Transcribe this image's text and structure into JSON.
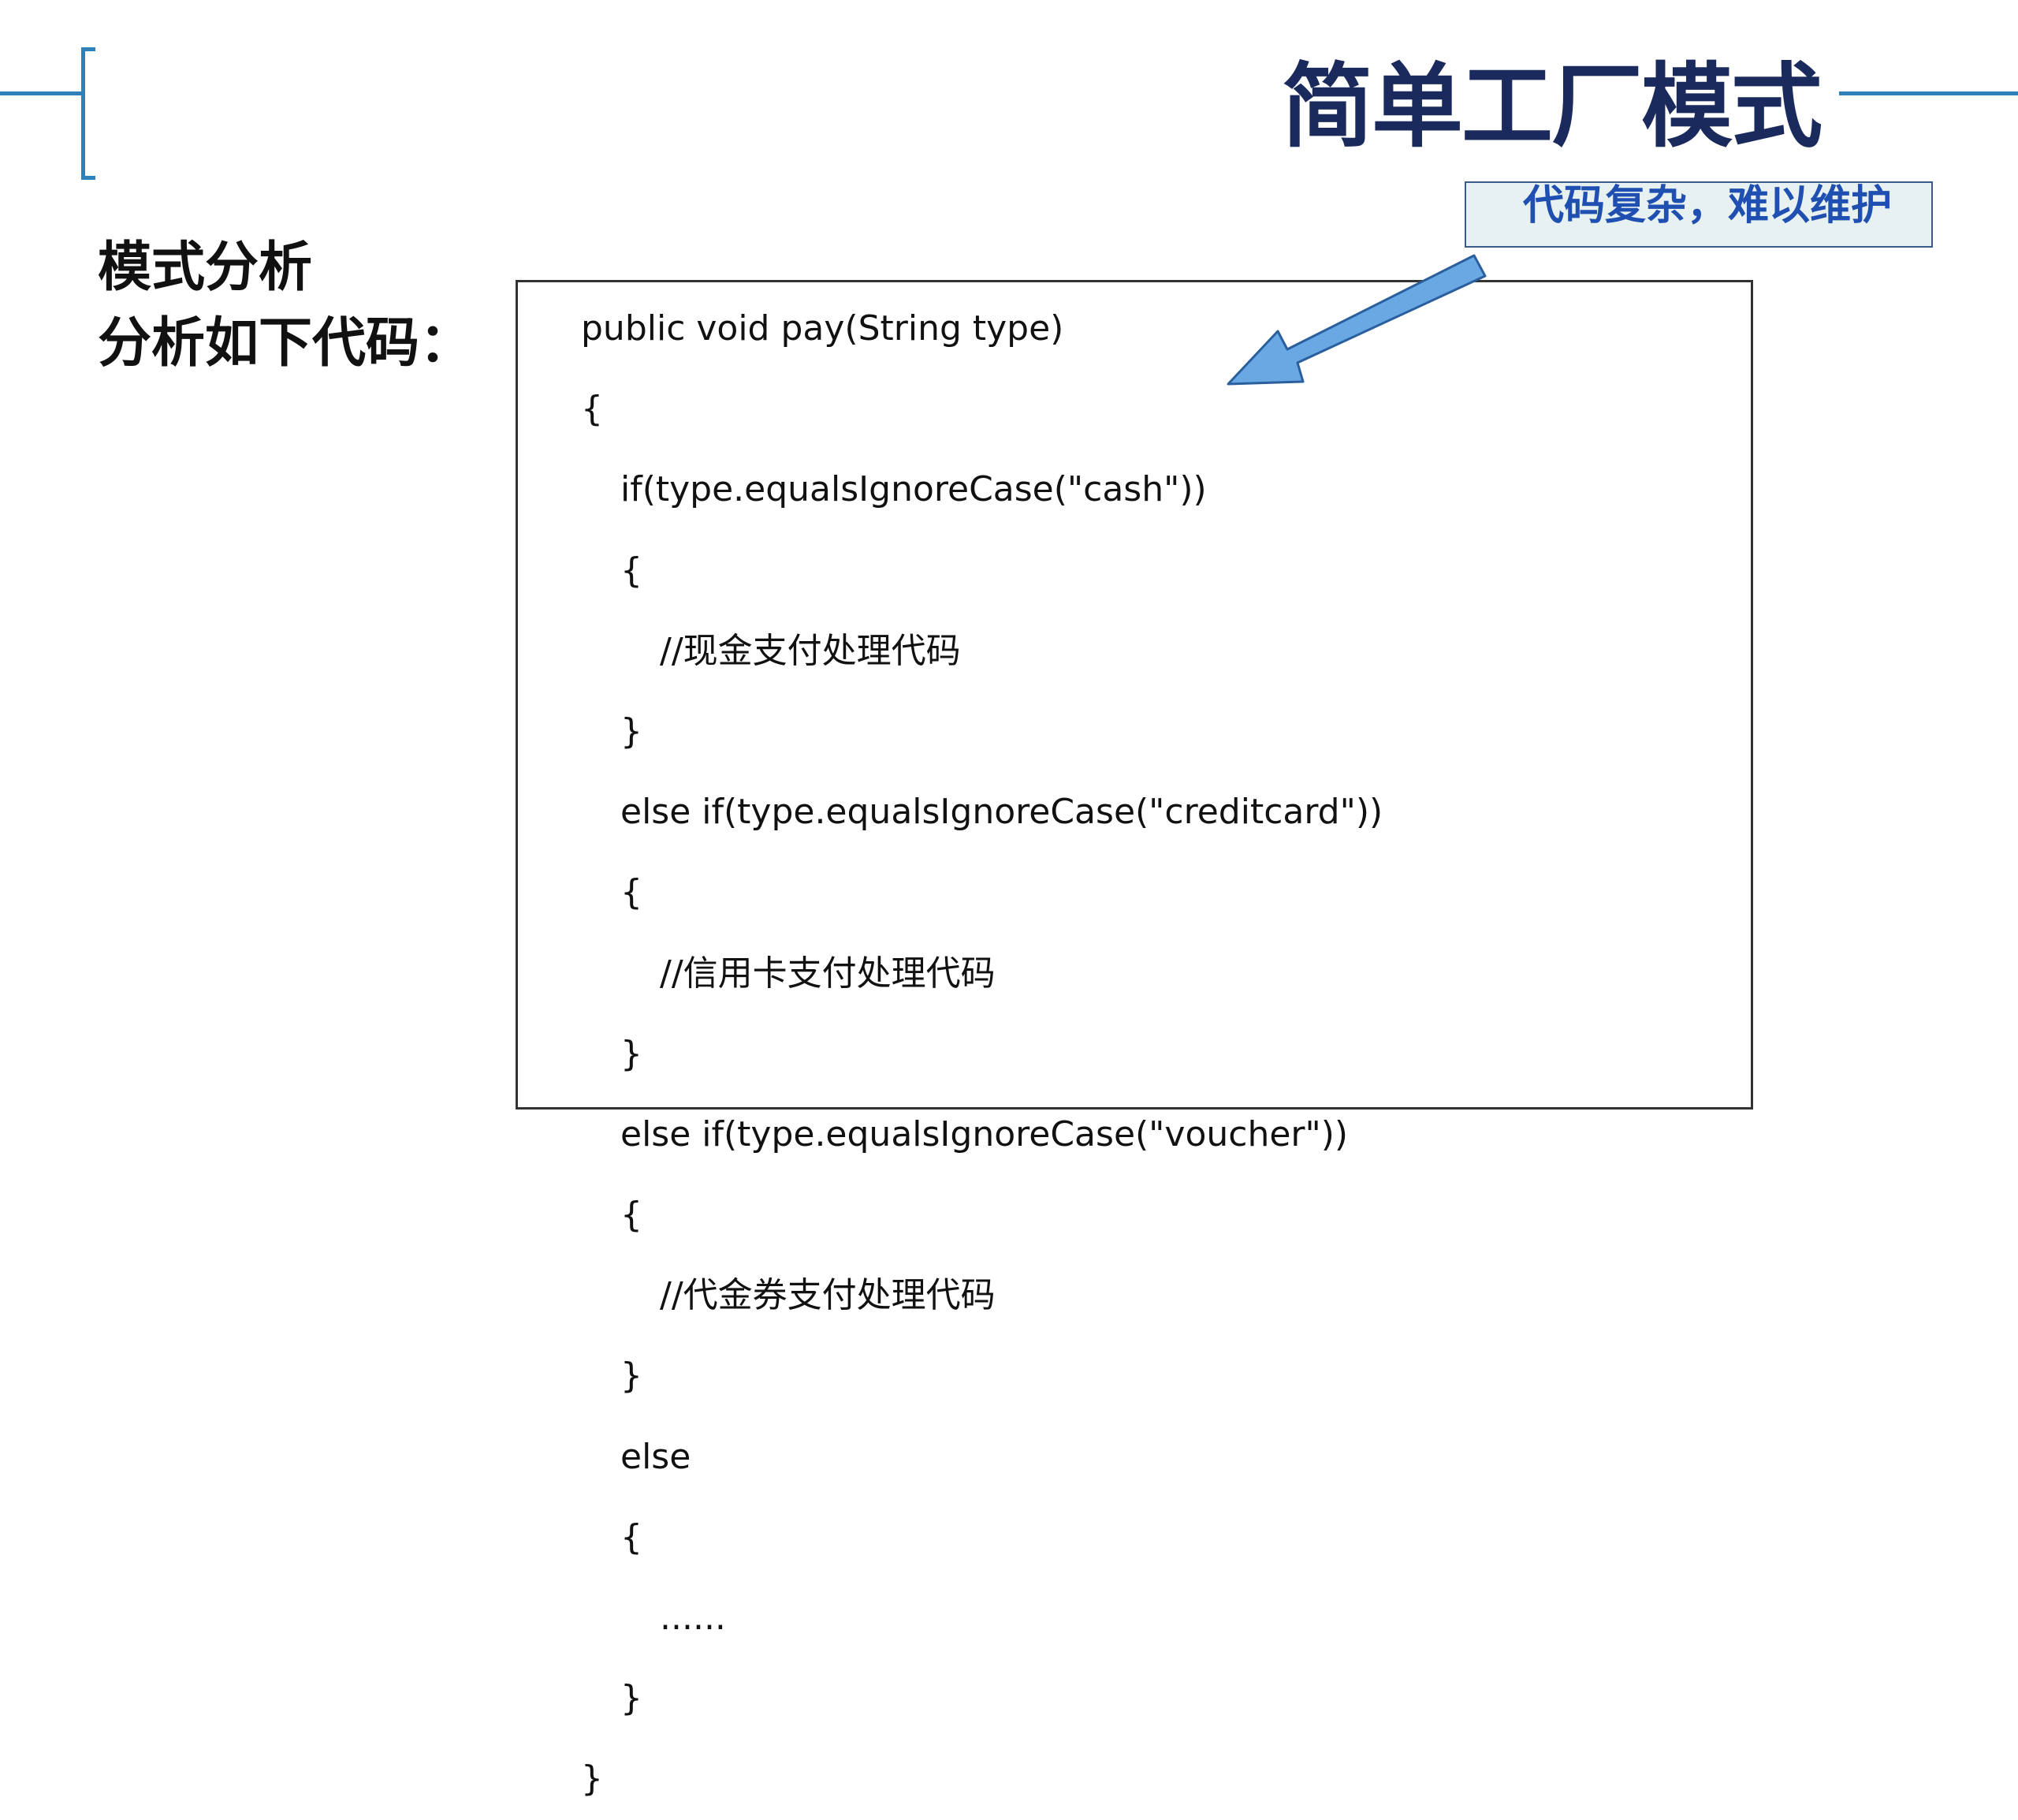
{
  "slide": {
    "title": "简单工厂模式",
    "callout_text": "代码复杂，难以维护",
    "heading_line1": "模式分析",
    "heading_line2": "分析如下代码：",
    "accent_color": "#2f7fb8",
    "title_color": "#1a2a5c",
    "arrow_color": "#6aa8e4",
    "code": {
      "lines": [
        "public void pay(String type)",
        "{",
        "if(type.equalsIgnoreCase(\"cash\"))",
        "{",
        "//现金支付处理代码",
        "}",
        "else if(type.equalsIgnoreCase(\"creditcard\"))",
        "{",
        "//信用卡支付处理代码",
        "}",
        "else if(type.equalsIgnoreCase(\"voucher\"))",
        "{",
        "//代金券支付处理代码",
        "}",
        "else",
        "{",
        "......",
        "}",
        "}"
      ]
    }
  }
}
